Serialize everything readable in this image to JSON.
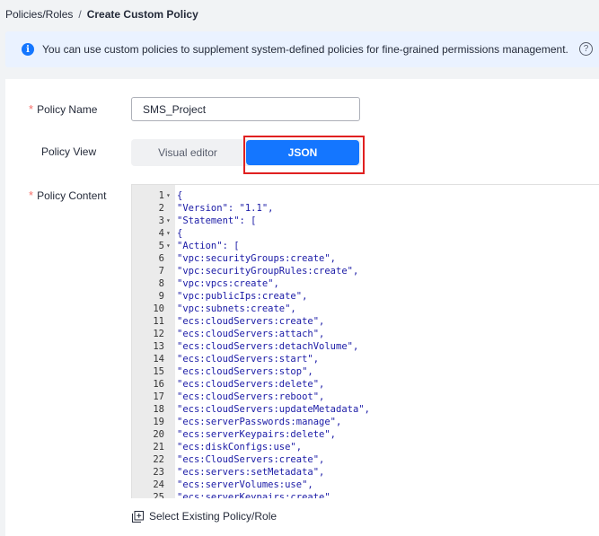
{
  "breadcrumb": {
    "parent": "Policies/Roles",
    "separator": "/",
    "current": "Create Custom Policy"
  },
  "notice": {
    "icon": "info-icon",
    "text": "You can use custom policies to supplement system-defined policies for fine-grained permissions management.",
    "help_icon": "help-icon",
    "help_symbol": "?"
  },
  "form": {
    "required_mark": "*",
    "policy_name_label": "Policy Name",
    "policy_name_value": "SMS_Project",
    "policy_view_label": "Policy View",
    "view_options": [
      "Visual editor",
      "JSON"
    ],
    "selected_view": "JSON",
    "policy_content_label": "Policy Content"
  },
  "editor": {
    "lines": [
      {
        "n": "1",
        "fold": true,
        "text": "{"
      },
      {
        "n": "2",
        "fold": false,
        "text": "\"Version\": \"1.1\","
      },
      {
        "n": "3",
        "fold": true,
        "text": "\"Statement\": ["
      },
      {
        "n": "4",
        "fold": true,
        "text": "{"
      },
      {
        "n": "5",
        "fold": true,
        "text": "\"Action\": ["
      },
      {
        "n": "6",
        "fold": false,
        "text": "\"vpc:securityGroups:create\","
      },
      {
        "n": "7",
        "fold": false,
        "text": "\"vpc:securityGroupRules:create\","
      },
      {
        "n": "8",
        "fold": false,
        "text": "\"vpc:vpcs:create\","
      },
      {
        "n": "9",
        "fold": false,
        "text": "\"vpc:publicIps:create\","
      },
      {
        "n": "10",
        "fold": false,
        "text": "\"vpc:subnets:create\","
      },
      {
        "n": "11",
        "fold": false,
        "text": "\"ecs:cloudServers:create\","
      },
      {
        "n": "12",
        "fold": false,
        "text": "\"ecs:cloudServers:attach\","
      },
      {
        "n": "13",
        "fold": false,
        "text": "\"ecs:cloudServers:detachVolume\","
      },
      {
        "n": "14",
        "fold": false,
        "text": "\"ecs:cloudServers:start\","
      },
      {
        "n": "15",
        "fold": false,
        "text": "\"ecs:cloudServers:stop\","
      },
      {
        "n": "16",
        "fold": false,
        "text": "\"ecs:cloudServers:delete\","
      },
      {
        "n": "17",
        "fold": false,
        "text": "\"ecs:cloudServers:reboot\","
      },
      {
        "n": "18",
        "fold": false,
        "text": "\"ecs:cloudServers:updateMetadata\","
      },
      {
        "n": "19",
        "fold": false,
        "text": "\"ecs:serverPasswords:manage\","
      },
      {
        "n": "20",
        "fold": false,
        "text": "\"ecs:serverKeypairs:delete\","
      },
      {
        "n": "21",
        "fold": false,
        "text": "\"ecs:diskConfigs:use\","
      },
      {
        "n": "22",
        "fold": false,
        "text": "\"ecs:CloudServers:create\","
      },
      {
        "n": "23",
        "fold": false,
        "text": "\"ecs:servers:setMetadata\","
      },
      {
        "n": "24",
        "fold": false,
        "text": "\"ecs:serverVolumes:use\","
      },
      {
        "n": "25",
        "fold": false,
        "text": "\"ecs:serverKeypairs:create\","
      }
    ]
  },
  "select_existing": {
    "icon": "plus-square-icon",
    "label": "Select Existing Policy/Role"
  },
  "colors": {
    "accent": "#1476ff",
    "required": "#f66f6a",
    "highlight": "#e02020",
    "notice_bg": "#eaf2ff"
  }
}
